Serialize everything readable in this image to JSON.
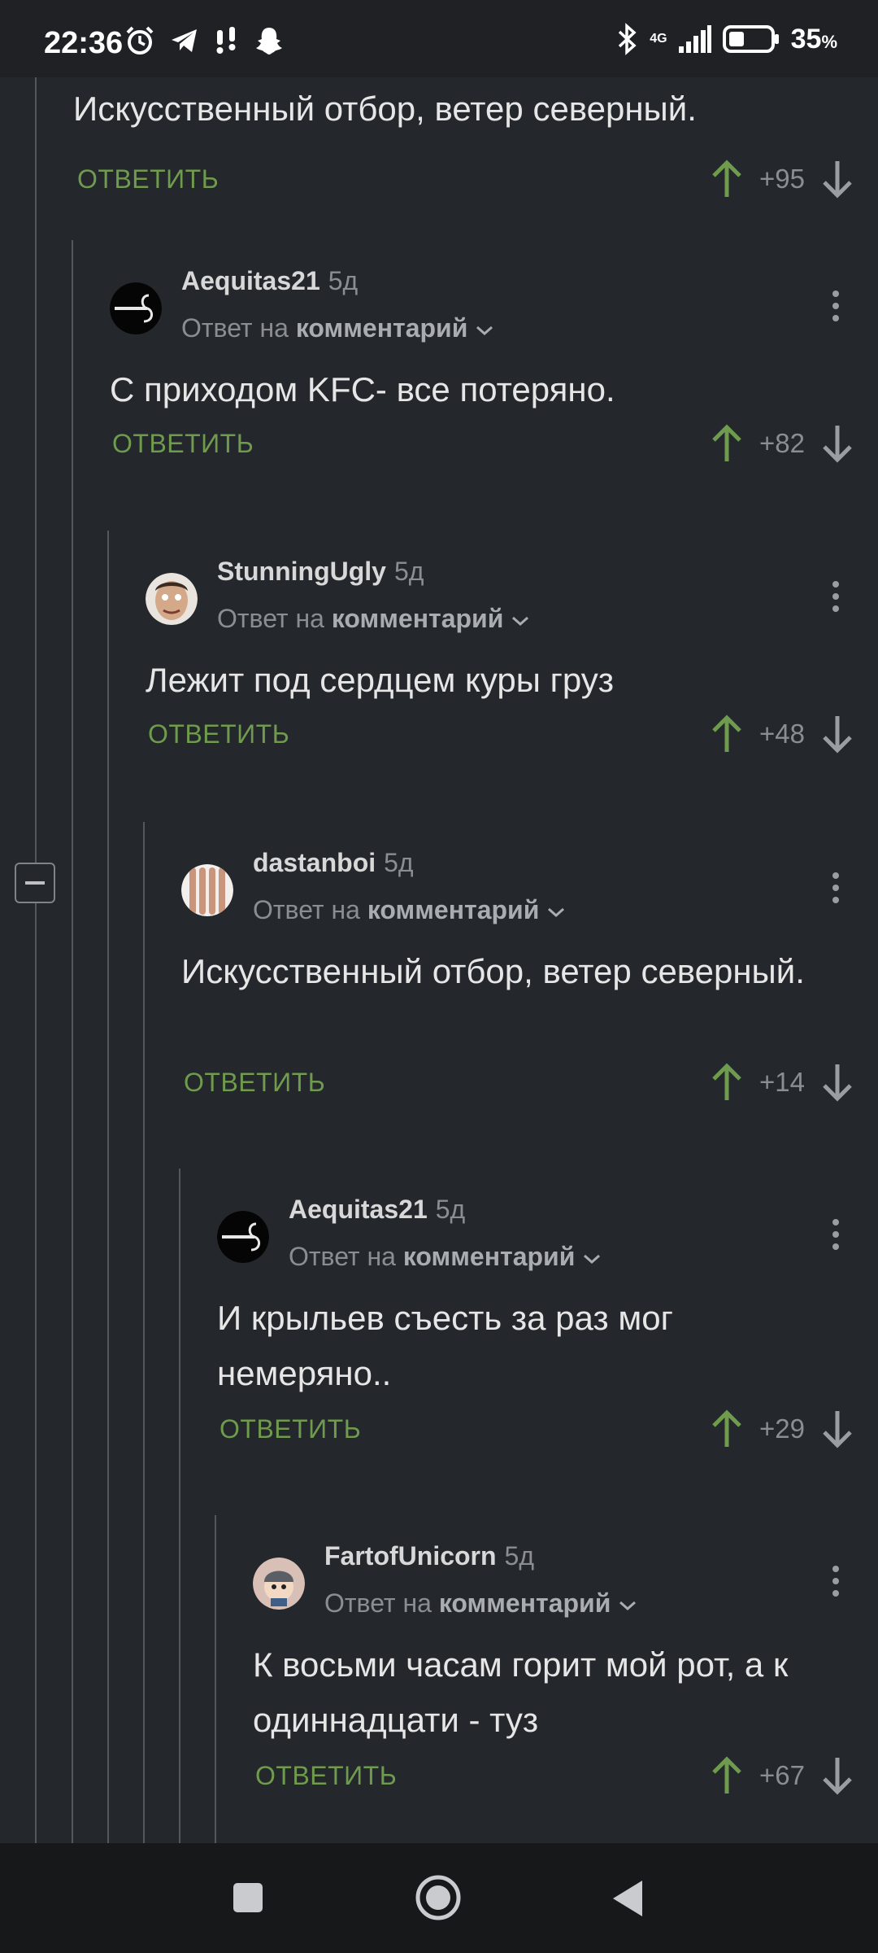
{
  "status_bar": {
    "time": "22:36",
    "network": "4G",
    "battery": "35",
    "battery_unit": "%",
    "icons": [
      "alarm-icon",
      "telegram-icon",
      "notification-icon",
      "snapchat-icon",
      "bluetooth-icon",
      "signal-icon",
      "battery-icon"
    ]
  },
  "labels": {
    "reply_to_prefix": "Ответ на",
    "reply_to_target": "комментарий",
    "reply_button": "ОТВЕТИТЬ"
  },
  "top_comment": {
    "text": "Искусственный отбор, ветер северный.",
    "score": "+95"
  },
  "comments": [
    {
      "user": "Aequitas21",
      "age": "5д",
      "text": "С приходом KFC- все потеряно.",
      "score": "+82",
      "avatar": "aequitas-logo"
    },
    {
      "user": "StunningUgly",
      "age": "5д",
      "text": "Лежит под сердцем куры груз",
      "score": "+48",
      "avatar": "face-photo"
    },
    {
      "user": "dastanboi",
      "age": "5д",
      "text": "Искусственный отбор, ветер северный.",
      "score": "+14",
      "avatar": "legs-photo"
    },
    {
      "user": "Aequitas21",
      "age": "5д",
      "text": "И крыльев съесть за раз мог немеряно..",
      "score": "+29",
      "avatar": "aequitas-logo"
    },
    {
      "user": "FartofUnicorn",
      "age": "5д",
      "text": "К восьми часам горит мой рот, а к одиннадцати - туз",
      "score": "+67",
      "avatar": "cartoon-avatar"
    }
  ],
  "colors": {
    "background": "#24272b",
    "reply_green": "#6f9b4e",
    "vote_up": "#6f9b4e",
    "muted_text": "#8a8d91"
  }
}
